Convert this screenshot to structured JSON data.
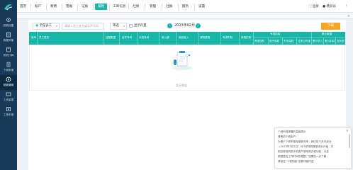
{
  "sidebar": {
    "items": [
      {
        "label": "税税设置",
        "icon": "settings-icon"
      },
      {
        "label": "数据采集",
        "icon": "collect-icon"
      },
      {
        "label": "税税计算",
        "icon": "calc-icon"
      },
      {
        "label": "个税申报",
        "icon": "declare-icon"
      },
      {
        "label": "税款缴纳",
        "icon": "pay-icon"
      },
      {
        "label": "工资单据",
        "icon": "payslip-icon"
      },
      {
        "label": "工单申报",
        "icon": "ticket-icon"
      }
    ]
  },
  "nav": {
    "items": [
      "首页",
      "账户",
      "税费",
      "票据",
      "记账",
      "报税",
      "工商信息",
      "社保",
      "管理",
      "社群",
      "服务",
      "设置"
    ],
    "active": "报税",
    "fullscreen": "全屏",
    "user": "杨云长"
  },
  "toolbar": {
    "company": "全部员工",
    "search_placeholder": "请输入员工姓名或证件号码",
    "filter": "筛选",
    "checkbox_label": "显示存量",
    "period": "2023年02月",
    "prev": "‹",
    "next": "›",
    "action": "下载"
  },
  "table": {
    "headers": [
      "序号",
      "员工姓名",
      "证照类型",
      "证件号码",
      "手机号码",
      "收入额",
      "免税收入",
      "减除费用",
      "专项扣除",
      "其他扣除",
      "应纳税所得额"
    ],
    "group_headers": [
      "专项扣除",
      "累计数据"
    ],
    "sub_headers": [
      "养老保险",
      "医疗保险",
      "失业保险",
      "住房公积金",
      "累计收入",
      "累计扣除",
      "应补退"
    ],
    "empty_text": "暂无数据"
  },
  "popup": {
    "title": "个税申报提醒的温馨提示",
    "lines": [
      "尊敬的个税用户：",
      "为便于个税申报及缴款效率，我们将于本月起对",
      "（2023年3月7日）对个税申报缴税进行升级，并",
      "相应使用税务手机客户端申报办税功能，以及",
      "税税提交工作时间的调整，如需进一步了解，",
      "请前往“个税扣缴”查看详细内容"
    ],
    "close": "×"
  }
}
